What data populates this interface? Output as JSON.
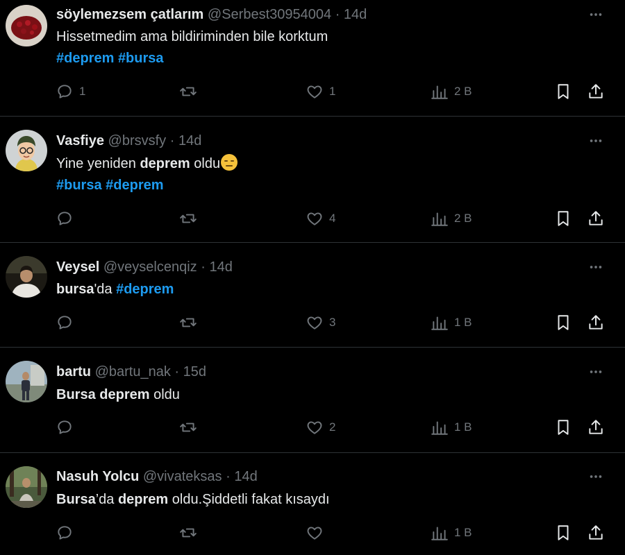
{
  "tweets": [
    {
      "name": "söylemezsem çatlarım",
      "handle": "@Serbest30954004",
      "time": "14d",
      "text": "Hissetmedim ama bildiriminden bile korktum",
      "hashtags_line": [
        "#deprem",
        "#bursa"
      ],
      "replies": "1",
      "reposts": "",
      "likes": "1",
      "views": "2 B"
    },
    {
      "name": "Vasfiye",
      "handle": "@brsvsfy",
      "time": "14d",
      "text_parts": [
        "Yine yeniden ",
        "deprem",
        " oldu"
      ],
      "emoji": "expressionless-face-emoji",
      "hashtags_line": [
        "#bursa",
        "#deprem"
      ],
      "replies": "",
      "reposts": "",
      "likes": "4",
      "views": "2 B"
    },
    {
      "name": "Veysel",
      "handle": "@veyselcenqiz",
      "time": "14d",
      "text_parts": [
        "bursa",
        "'da ",
        "#deprem"
      ],
      "replies": "",
      "reposts": "",
      "likes": "3",
      "views": "1 B"
    },
    {
      "name": "bartu",
      "handle": "@bartu_nak",
      "time": "15d",
      "text_parts": [
        "Bursa",
        " ",
        "deprem",
        " oldu"
      ],
      "replies": "",
      "reposts": "",
      "likes": "2",
      "views": "1 B"
    },
    {
      "name": "Nasuh Yolcu",
      "handle": "@vivateksas",
      "time": "14d",
      "text_parts": [
        "Bursa",
        "’da ",
        "deprem",
        " oldu.Şiddetli fakat kısaydı"
      ],
      "replies": "",
      "reposts": "",
      "likes": "",
      "views": "1 B"
    }
  ],
  "separator": "·",
  "colors": {
    "background": "#000000",
    "text": "#e7e9ea",
    "muted": "#71767b",
    "hashtag": "#1d9bf0",
    "divider": "#2f3336"
  }
}
